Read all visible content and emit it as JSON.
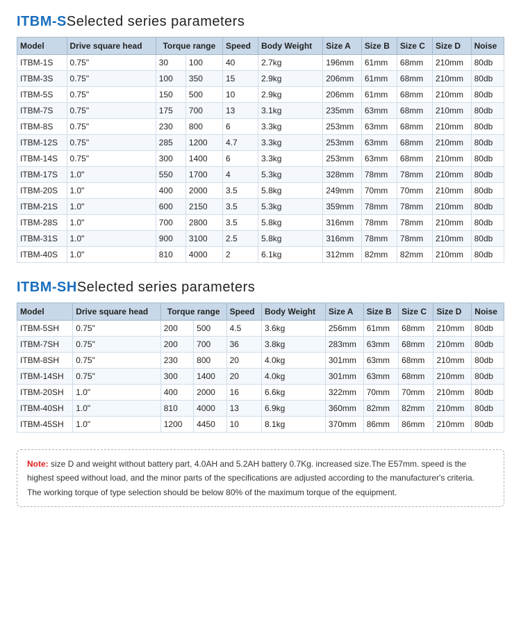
{
  "section1": {
    "title_colored": "ITBM-S",
    "title_normal": "Selected series parameters",
    "columns": [
      "Model",
      "Drive square head",
      "Torque range",
      "",
      "Speed",
      "Body Weight",
      "Size A",
      "Size B",
      "Size C",
      "Size D",
      "Noise"
    ],
    "columns_display": [
      "Model",
      "Drive square head",
      "Torque range",
      "Speed",
      "Body Weight",
      "Size A",
      "Size B",
      "Size C",
      "Size D",
      "Noise"
    ],
    "rows": [
      [
        "ITBM-1S",
        "0.75\"",
        "30",
        "100",
        "40",
        "2.7kg",
        "196mm",
        "61mm",
        "68mm",
        "210mm",
        "80db"
      ],
      [
        "ITBM-3S",
        "0.75\"",
        "100",
        "350",
        "15",
        "2.9kg",
        "206mm",
        "61mm",
        "68mm",
        "210mm",
        "80db"
      ],
      [
        "ITBM-5S",
        "0.75\"",
        "150",
        "500",
        "10",
        "2.9kg",
        "206mm",
        "61mm",
        "68mm",
        "210mm",
        "80db"
      ],
      [
        "ITBM-7S",
        "0.75\"",
        "175",
        "700",
        "13",
        "3.1kg",
        "235mm",
        "63mm",
        "68mm",
        "210mm",
        "80db"
      ],
      [
        "ITBM-8S",
        "0.75\"",
        "230",
        "800",
        "6",
        "3.3kg",
        "253mm",
        "63mm",
        "68mm",
        "210mm",
        "80db"
      ],
      [
        "ITBM-12S",
        "0.75\"",
        "285",
        "1200",
        "4.7",
        "3.3kg",
        "253mm",
        "63mm",
        "68mm",
        "210mm",
        "80db"
      ],
      [
        "ITBM-14S",
        "0.75\"",
        "300",
        "1400",
        "6",
        "3.3kg",
        "253mm",
        "63mm",
        "68mm",
        "210mm",
        "80db"
      ],
      [
        "ITBM-17S",
        "1.0\"",
        "550",
        "1700",
        "4",
        "5.3kg",
        "328mm",
        "78mm",
        "78mm",
        "210mm",
        "80db"
      ],
      [
        "ITBM-20S",
        "1.0\"",
        "400",
        "2000",
        "3.5",
        "5.8kg",
        "249mm",
        "70mm",
        "70mm",
        "210mm",
        "80db"
      ],
      [
        "ITBM-21S",
        "1.0\"",
        "600",
        "2150",
        "3.5",
        "5.3kg",
        "359mm",
        "78mm",
        "78mm",
        "210mm",
        "80db"
      ],
      [
        "ITBM-28S",
        "1.0\"",
        "700",
        "2800",
        "3.5",
        "5.8kg",
        "316mm",
        "78mm",
        "78mm",
        "210mm",
        "80db"
      ],
      [
        "ITBM-31S",
        "1.0\"",
        "900",
        "3100",
        "2.5",
        "5.8kg",
        "316mm",
        "78mm",
        "78mm",
        "210mm",
        "80db"
      ],
      [
        "ITBM-40S",
        "1.0\"",
        "810",
        "4000",
        "2",
        "6.1kg",
        "312mm",
        "82mm",
        "82mm",
        "210mm",
        "80db"
      ]
    ]
  },
  "section2": {
    "title_colored": "ITBM-SH",
    "title_normal": "Selected series parameters",
    "rows": [
      [
        "ITBM-5SH",
        "0.75\"",
        "200",
        "500",
        "4.5",
        "3.6kg",
        "256mm",
        "61mm",
        "68mm",
        "210mm",
        "80db"
      ],
      [
        "ITBM-7SH",
        "0.75\"",
        "200",
        "700",
        "36",
        "3.8kg",
        "283mm",
        "63mm",
        "68mm",
        "210mm",
        "80db"
      ],
      [
        "ITBM-8SH",
        "0.75\"",
        "230",
        "800",
        "20",
        "4.0kg",
        "301mm",
        "63mm",
        "68mm",
        "210mm",
        "80db"
      ],
      [
        "ITBM-14SH",
        "0.75\"",
        "300",
        "1400",
        "20",
        "4.0kg",
        "301mm",
        "63mm",
        "68mm",
        "210mm",
        "80db"
      ],
      [
        "ITBM-20SH",
        "1.0\"",
        "400",
        "2000",
        "16",
        "6.6kg",
        "322mm",
        "70mm",
        "70mm",
        "210mm",
        "80db"
      ],
      [
        "ITBM-40SH",
        "1.0\"",
        "810",
        "4000",
        "13",
        "6.9kg",
        "360mm",
        "82mm",
        "82mm",
        "210mm",
        "80db"
      ],
      [
        "ITBM-45SH",
        "1.0\"",
        "1200",
        "4450",
        "10",
        "8.1kg",
        "370mm",
        "86mm",
        "86mm",
        "210mm",
        "80db"
      ]
    ]
  },
  "note": {
    "label": "Note:",
    "text": " size D and weight without battery part, 4.0AH and 5.2AH battery 0.7Kg. increased size.The E57mm. speed is the highest speed without load, and the minor parts of the specifications are adjusted according to the manufacturer's criteria.\nThe working torque of type selection should be below 80% of the maximum torque of the equipment."
  }
}
